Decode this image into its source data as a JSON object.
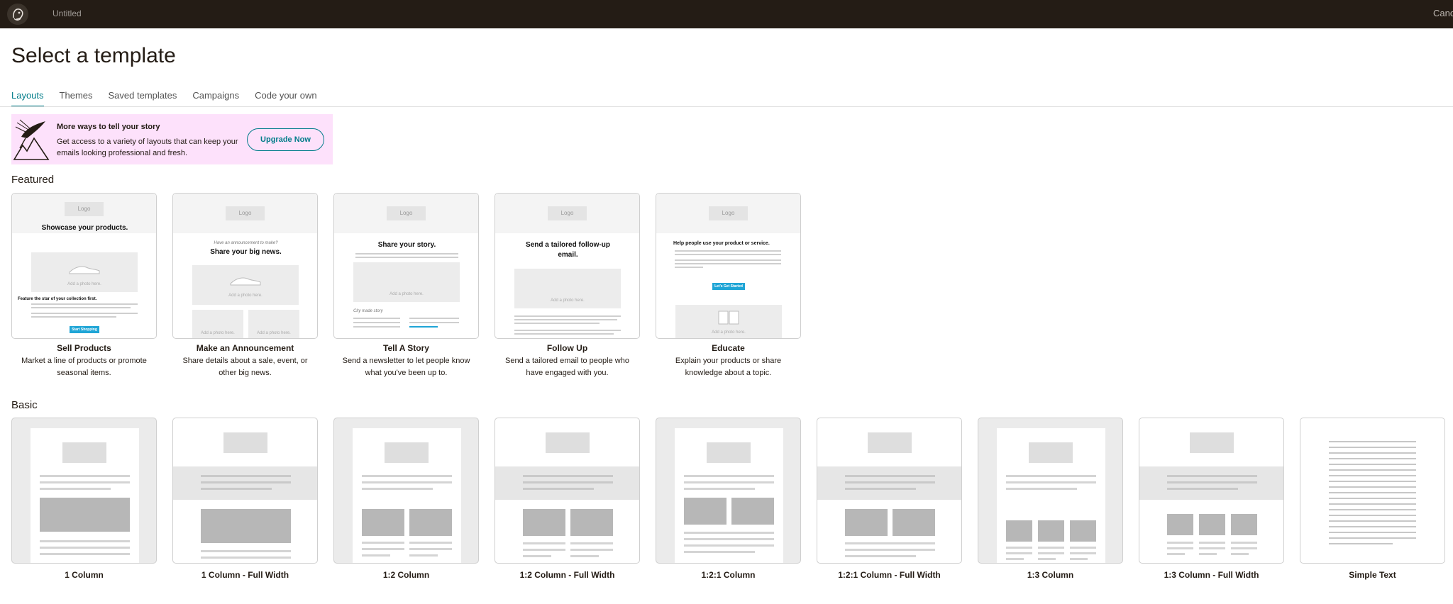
{
  "app": {
    "document_title": "Untitled",
    "cancel_label": "Cancel"
  },
  "page": {
    "title": "Select a template"
  },
  "tabs": [
    {
      "label": "Layouts",
      "active": true
    },
    {
      "label": "Themes",
      "active": false
    },
    {
      "label": "Saved templates",
      "active": false
    },
    {
      "label": "Campaigns",
      "active": false
    },
    {
      "label": "Code your own",
      "active": false
    }
  ],
  "promo": {
    "title": "More ways to tell your story",
    "text": "Get access to a variety of layouts that can keep your emails looking professional and fresh.",
    "button_label": "Upgrade Now"
  },
  "featured": {
    "heading": "Featured",
    "items": [
      {
        "name": "Sell Products",
        "description": "Market a line of products or promote seasonal items.",
        "thumb": {
          "logo": "Logo",
          "headline": "Showcase your products.",
          "photo": "Add a photo here.",
          "subhead": "Feature the star of your collection first.",
          "button": "Start Shopping"
        }
      },
      {
        "name": "Make an Announcement",
        "description": "Share details about a sale, event, or other big news.",
        "thumb": {
          "logo": "Logo",
          "kicker": "Have an announcement to make?",
          "headline": "Share your big news.",
          "photo": "Add a photo here.",
          "photo2": "Add a photo here.",
          "photo3": "Add a photo here."
        }
      },
      {
        "name": "Tell A Story",
        "description": "Send a newsletter to let people know what you've been up to.",
        "thumb": {
          "logo": "Logo",
          "headline": "Share your story.",
          "photo": "Add a photo here.",
          "caption": "City made story"
        }
      },
      {
        "name": "Follow Up",
        "description": "Send a tailored email to people who have engaged with you.",
        "thumb": {
          "logo": "Logo",
          "headline": "Send a tailored follow-up email.",
          "photo": "Add a photo here."
        }
      },
      {
        "name": "Educate",
        "description": "Explain your products or share knowledge about a topic.",
        "thumb": {
          "logo": "Logo",
          "headline": "Help people use your product or service.",
          "button": "Let's Get Started",
          "photo": "Add a photo here."
        }
      }
    ]
  },
  "basic": {
    "heading": "Basic",
    "items": [
      {
        "name": "1 Column"
      },
      {
        "name": "1 Column - Full Width"
      },
      {
        "name": "1:2 Column"
      },
      {
        "name": "1:2 Column - Full Width"
      },
      {
        "name": "1:2:1 Column"
      },
      {
        "name": "1:2:1 Column - Full Width"
      },
      {
        "name": "1:3 Column"
      },
      {
        "name": "1:3 Column - Full Width"
      },
      {
        "name": "Simple Text"
      }
    ]
  },
  "colors": {
    "topbar": "#241c15",
    "accent": "#007c89",
    "promo_bg": "#fde1fb",
    "cta_blue": "#1fa5d6"
  },
  "icons": {
    "brand": "mailchimp-freddie-icon",
    "promo_art": "mountain-bird-illustration-icon"
  }
}
